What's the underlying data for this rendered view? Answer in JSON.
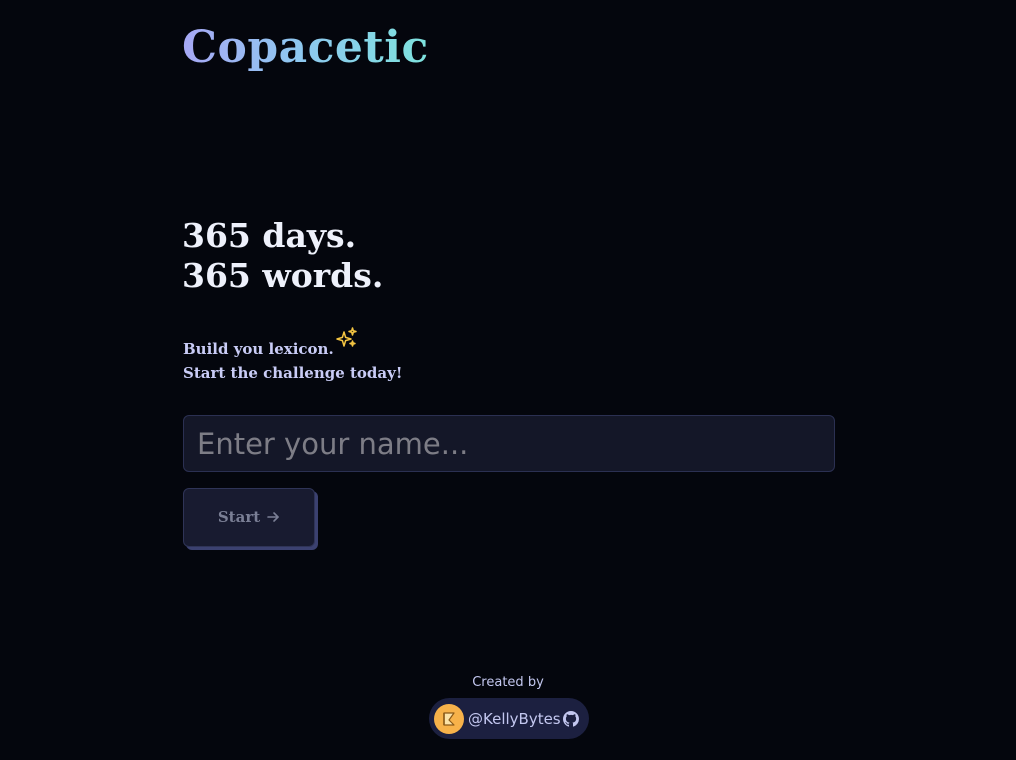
{
  "app": {
    "logo_text": "Copacetic"
  },
  "hero": {
    "headline_line1": "365 days.",
    "headline_line2": "365 words.",
    "tagline_line1": "Build you lexicon.",
    "tagline_line2": "Start the challenge today!",
    "sparkle_icon": "sparkles-icon",
    "sparkle_color": "#f5c542"
  },
  "form": {
    "name_value": "",
    "name_placeholder": "Enter your name...",
    "start_label": "Start",
    "start_icon": "arrow-right-icon"
  },
  "footer": {
    "created_by": "Created by",
    "author_handle": "@KellyBytes",
    "avatar_icon": "avatar-icon",
    "github_icon": "github-icon"
  },
  "colors": {
    "background": "#04060d",
    "logo_gradient": [
      "#a7a8f5",
      "#8fc6f0",
      "#7ee3de"
    ],
    "tagline": "#c9ccf6",
    "input_background": "#141728",
    "button_background": "#181b30",
    "chip_background": "#1c2040",
    "avatar": "#f7b24a"
  }
}
